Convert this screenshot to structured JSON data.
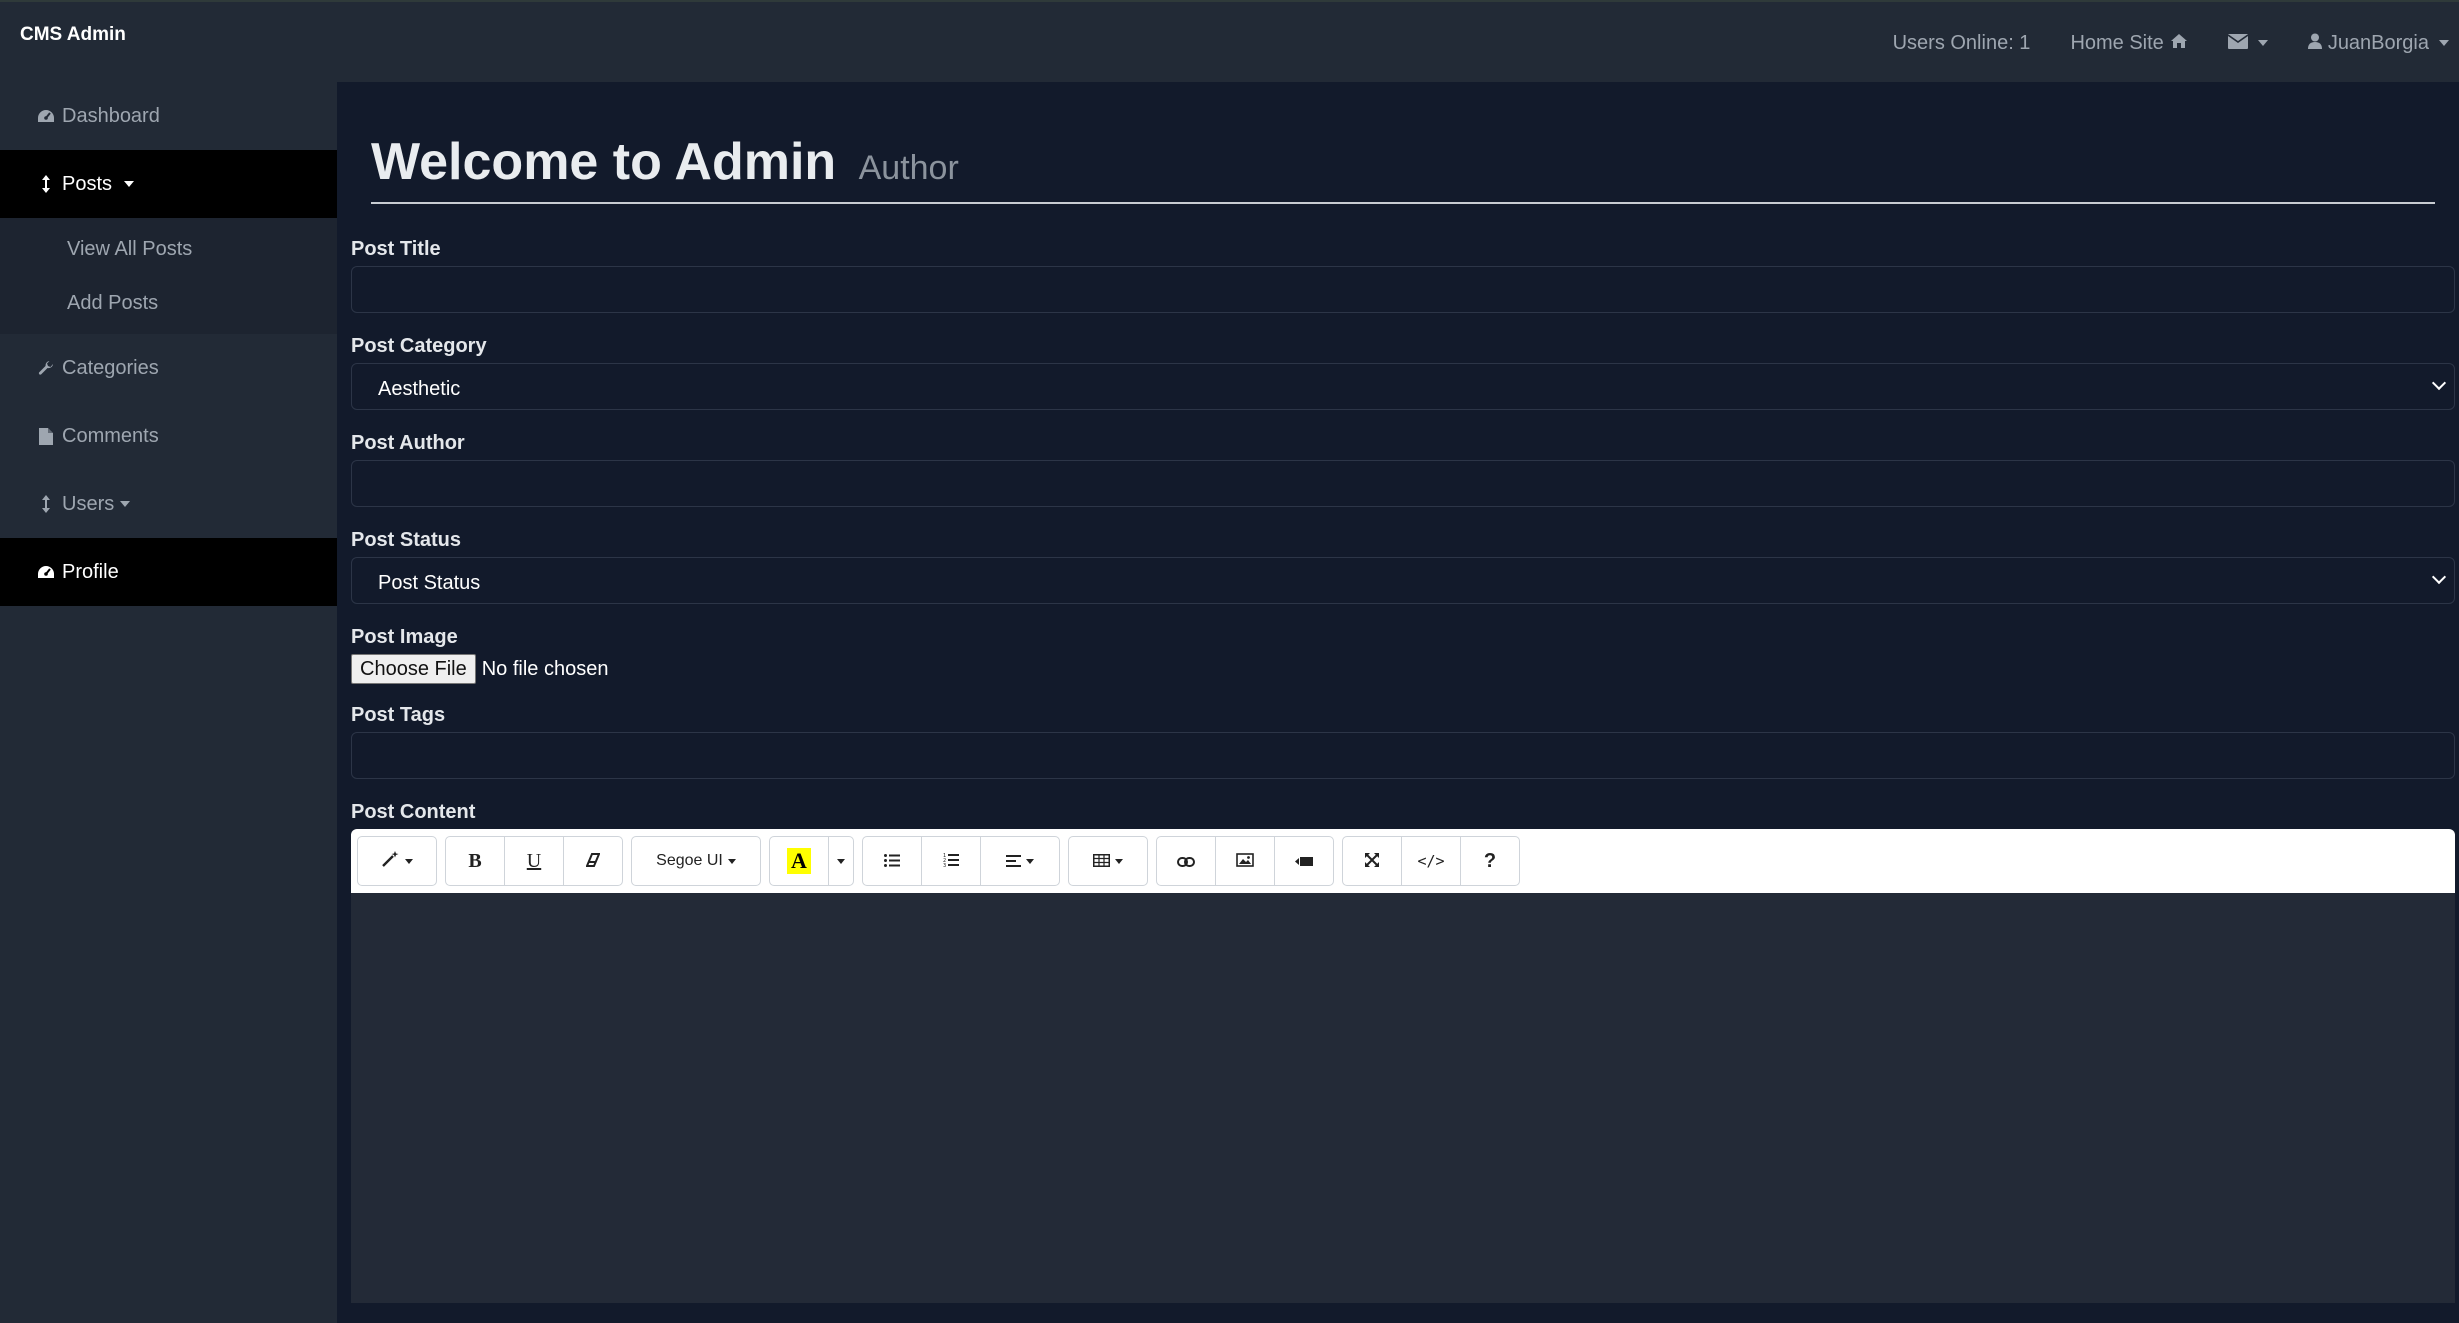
{
  "app": {
    "brand": "CMS Admin"
  },
  "topnav": {
    "users_online": "Users Online: 1",
    "home_site": "Home Site",
    "user": "JuanBorgia"
  },
  "sidebar": {
    "items": [
      {
        "label": "Dashboard",
        "icon": "dashboard-icon"
      },
      {
        "label": "Posts",
        "icon": "sort-icon",
        "active": true,
        "children": [
          {
            "label": "View All Posts"
          },
          {
            "label": "Add Posts"
          }
        ]
      },
      {
        "label": "Categories",
        "icon": "wrench-icon"
      },
      {
        "label": "Comments",
        "icon": "file-icon"
      },
      {
        "label": "Users",
        "icon": "sort-icon"
      },
      {
        "label": "Profile",
        "icon": "dashboard-icon",
        "active": true
      }
    ]
  },
  "page": {
    "title": "Welcome to Admin",
    "subtitle": "Author"
  },
  "form": {
    "post_title_label": "Post Title",
    "post_title_value": "",
    "post_category_label": "Post Category",
    "post_category_value": "Aesthetic",
    "post_author_label": "Post Author",
    "post_author_value": "",
    "post_status_label": "Post Status",
    "post_status_value": "Post Status",
    "post_image_label": "Post Image",
    "file_button": "Choose File",
    "file_status": "No file chosen",
    "post_tags_label": "Post Tags",
    "post_tags_value": "",
    "post_content_label": "Post Content"
  },
  "editor": {
    "font_name": "Segoe UI",
    "bold": "B",
    "underline": "U",
    "code_view": "</>",
    "help": "?",
    "highlight_color": "#ffff00"
  },
  "colors": {
    "page_bg": "#121a2b",
    "nav_bg": "#222a36",
    "active_bg": "#000000",
    "editor_bg": "#232a37"
  }
}
